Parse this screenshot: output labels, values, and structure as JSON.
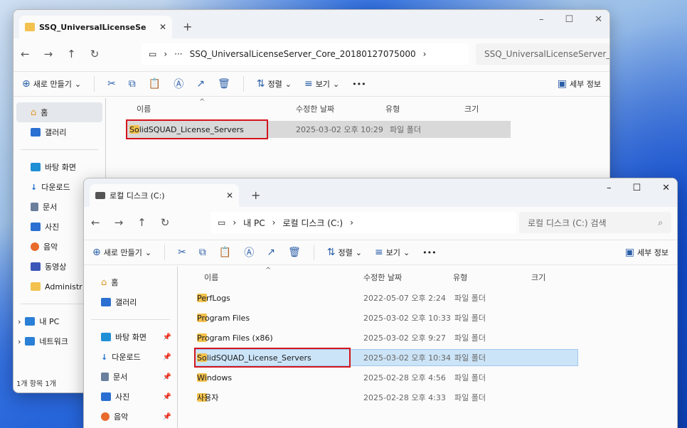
{
  "back_window": {
    "tab_title": "SSQ_UniversalLicenseServer_(",
    "path_segments": [
      "SSQ_UniversalLicenseServer_Core_20180127075000",
      "SSQ_UniversalLicenseServer_Co"
    ],
    "toolbar": {
      "new_label": "새로 만들기",
      "sort_label": "정렬",
      "view_label": "보기",
      "details_label": "세부 정보"
    },
    "columns": [
      "이름",
      "수정한 날짜",
      "유형",
      "크기"
    ],
    "files": [
      {
        "name": "SolidSQUAD_License_Servers",
        "date": "2025-03-02 오후 10:29",
        "type": "파일 폴더",
        "size": ""
      }
    ],
    "sidebar": [
      {
        "label": "홈",
        "icon": "home-icon"
      },
      {
        "label": "갤러리",
        "icon": "gallery-icon"
      },
      {
        "label": "바탕 화면",
        "icon": "desktop-icon"
      },
      {
        "label": "다운로드",
        "icon": "download-icon"
      },
      {
        "label": "문서",
        "icon": "document-icon"
      },
      {
        "label": "사진",
        "icon": "pictures-icon"
      },
      {
        "label": "음악",
        "icon": "music-icon"
      },
      {
        "label": "동영상",
        "icon": "video-icon"
      },
      {
        "label": "Administr",
        "icon": "folder-icon"
      },
      {
        "label": "내 PC",
        "icon": "pc-icon"
      },
      {
        "label": "네트워크",
        "icon": "network-icon"
      }
    ],
    "status": "1개 항목   1개"
  },
  "front_window": {
    "tab_title": "로컬 디스크 (C:)",
    "breadcrumb": [
      "내 PC",
      "로컬 디스크 (C:)"
    ],
    "search_placeholder": "로컬 디스크 (C:) 검색",
    "toolbar": {
      "new_label": "새로 만들기",
      "sort_label": "정렬",
      "view_label": "보기",
      "details_label": "세부 정보"
    },
    "columns": [
      "이름",
      "수정한 날짜",
      "유형",
      "크기"
    ],
    "files": [
      {
        "name": "PerfLogs",
        "date": "2022-05-07 오후 2:24",
        "type": "파일 폴더"
      },
      {
        "name": "Program Files",
        "date": "2025-03-02 오후 10:33",
        "type": "파일 폴더"
      },
      {
        "name": "Program Files (x86)",
        "date": "2025-03-02 오후 9:27",
        "type": "파일 폴더"
      },
      {
        "name": "SolidSQUAD_License_Servers",
        "date": "2025-03-02 오후 10:34",
        "type": "파일 폴더"
      },
      {
        "name": "Windows",
        "date": "2025-02-28 오후 4:56",
        "type": "파일 폴더"
      },
      {
        "name": "사용자",
        "date": "2025-02-28 오후 4:33",
        "type": "파일 폴더"
      }
    ],
    "sidebar": [
      {
        "label": "홈",
        "icon": "home-icon"
      },
      {
        "label": "갤러리",
        "icon": "gallery-icon"
      },
      {
        "label": "바탕 화면",
        "icon": "desktop-icon"
      },
      {
        "label": "다운로드",
        "icon": "download-icon"
      },
      {
        "label": "문서",
        "icon": "document-icon"
      },
      {
        "label": "사진",
        "icon": "pictures-icon"
      },
      {
        "label": "음악",
        "icon": "music-icon"
      }
    ]
  },
  "colors": {
    "highlight_red": "#d4141d",
    "selection_blue": "#cce4f7",
    "selection_grey": "#d9d9d9",
    "folder_yellow": "#f2c14e"
  }
}
